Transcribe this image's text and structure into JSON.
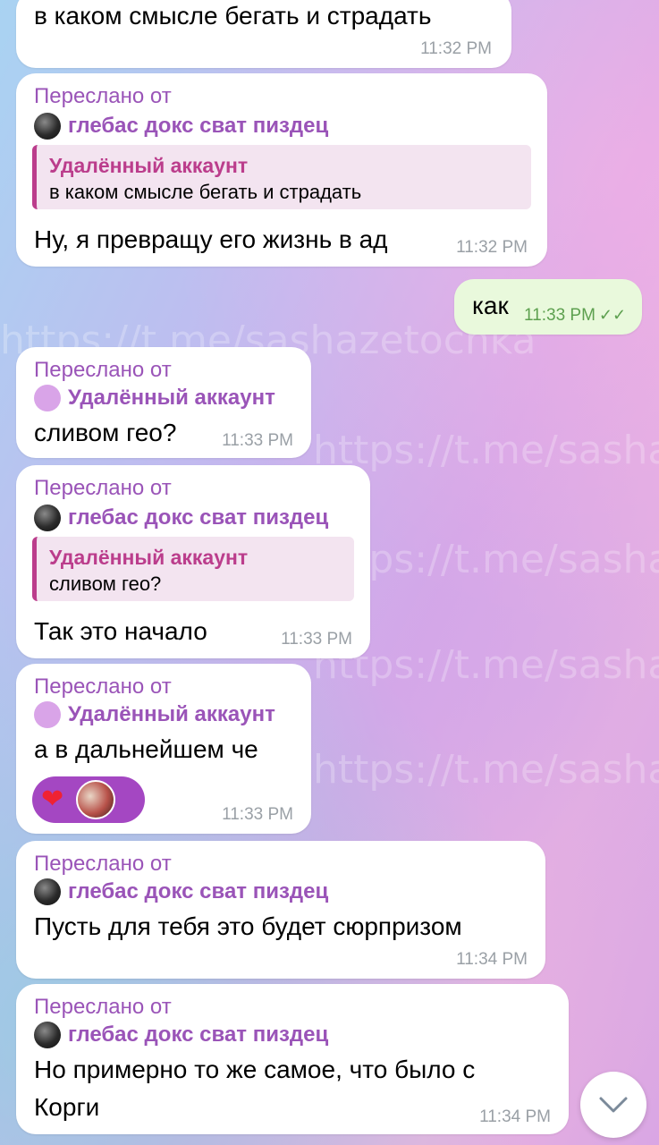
{
  "watermark": "https://t.me/sashazetochka",
  "colors": {
    "accent": "#9a54b8",
    "quote_author": "#bb3d8c",
    "outgoing_bubble": "#e9f9dc",
    "timestamp": "#9aa0a6"
  },
  "messages": [
    {
      "type": "incoming",
      "text": "в каком смысле бегать и страдать",
      "time": "11:32 PM"
    },
    {
      "type": "forwarded",
      "forwarded_label": "Переслано от",
      "sender": "глебас докс сват пиздец",
      "quote_author": "Удалённый аккаунт",
      "quote_text": "в каком смысле бегать и страдать",
      "text": "Ну, я превращу его жизнь в ад",
      "time": "11:32 PM"
    },
    {
      "type": "outgoing",
      "text": "как",
      "time": "11:33 PM",
      "status_icon": "double-check-icon"
    },
    {
      "type": "forwarded",
      "forwarded_label": "Переслано от",
      "sender": "Удалённый аккаунт",
      "text": "сливом гео?",
      "time": "11:33 PM"
    },
    {
      "type": "forwarded",
      "forwarded_label": "Переслано от",
      "sender": "глебас докс сват пиздец",
      "quote_author": "Удалённый аккаунт",
      "quote_text": "сливом гео?",
      "text": "Так это начало",
      "time": "11:33 PM"
    },
    {
      "type": "forwarded",
      "forwarded_label": "Переслано от",
      "sender": "Удалённый аккаунт",
      "text": "а в дальнейшем че",
      "reaction": "heart-icon",
      "time": "11:33 PM"
    },
    {
      "type": "forwarded",
      "forwarded_label": "Переслано от",
      "sender": "глебас докс сват пиздец",
      "text": "Пусть для тебя это будет сюрпризом",
      "time": "11:34 PM"
    },
    {
      "type": "forwarded",
      "forwarded_label": "Переслано от",
      "sender": "глебас докс сват пиздец",
      "text_line1": "Но примерно то же самое, что было с",
      "text_line2": "Корги",
      "time": "11:34 PM"
    }
  ],
  "scroll_down_icon": "chevron-down-icon"
}
